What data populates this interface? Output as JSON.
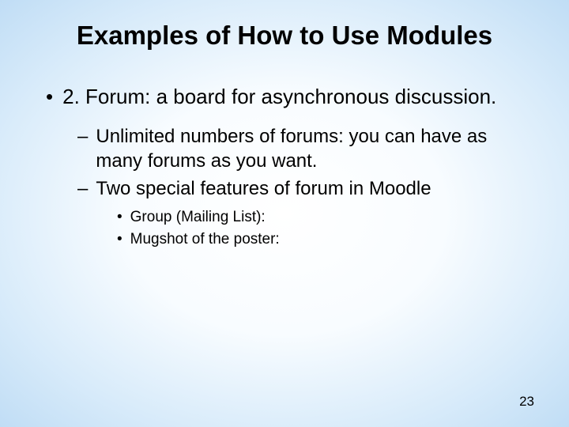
{
  "slide": {
    "title": "Examples of How to Use Modules",
    "bullets_l1": [
      {
        "text": "2. Forum: a board for asynchronous discussion."
      }
    ],
    "bullets_l2": [
      {
        "text": "Unlimited numbers of forums: you can have as many forums as you want."
      },
      {
        "text": "Two special features of forum in Moodle"
      }
    ],
    "bullets_l3": [
      {
        "text": "Group (Mailing List):"
      },
      {
        "text": "Mugshot of the poster:"
      }
    ],
    "page_number": "23"
  }
}
